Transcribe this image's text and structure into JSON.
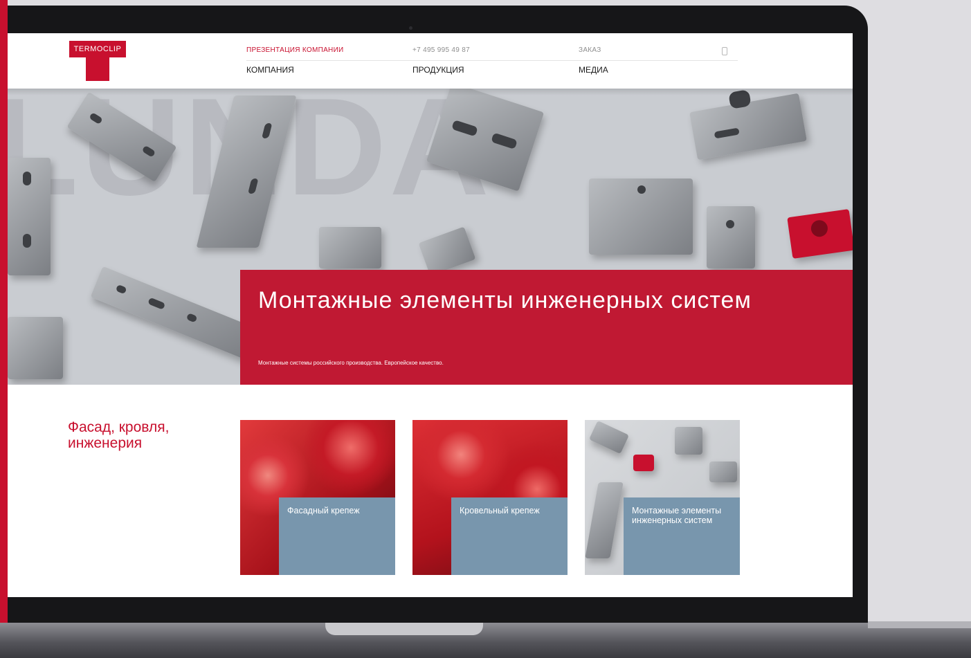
{
  "header": {
    "logo_text": "TERMOCLIP",
    "top_links": {
      "presentation": "ПРЕЗЕНТАЦИЯ КОМПАНИИ",
      "phone": "+7 495 995 49 87",
      "order": "ЗАКАЗ",
      "cart_count": "0"
    },
    "nav": {
      "company": "КОМПАНИЯ",
      "products": "ПРОДУКЦИЯ",
      "media": "МЕДИА"
    }
  },
  "hero": {
    "watermark": "LUNDA",
    "title": "Монтажные элементы инженерных систем",
    "subtitle": "Монтажные системы российского производства. Европейское качество."
  },
  "section": {
    "title": "Фасад, кровля, инженерия",
    "cards": [
      {
        "label": "Фасадный крепеж"
      },
      {
        "label": "Кровельный крепеж"
      },
      {
        "label": "Монтажные элементы инженерных систем"
      }
    ]
  },
  "colors": {
    "brand_red": "#c8102e",
    "card_blue": "#7896ad",
    "hero_grey": "#c9ccd1"
  }
}
